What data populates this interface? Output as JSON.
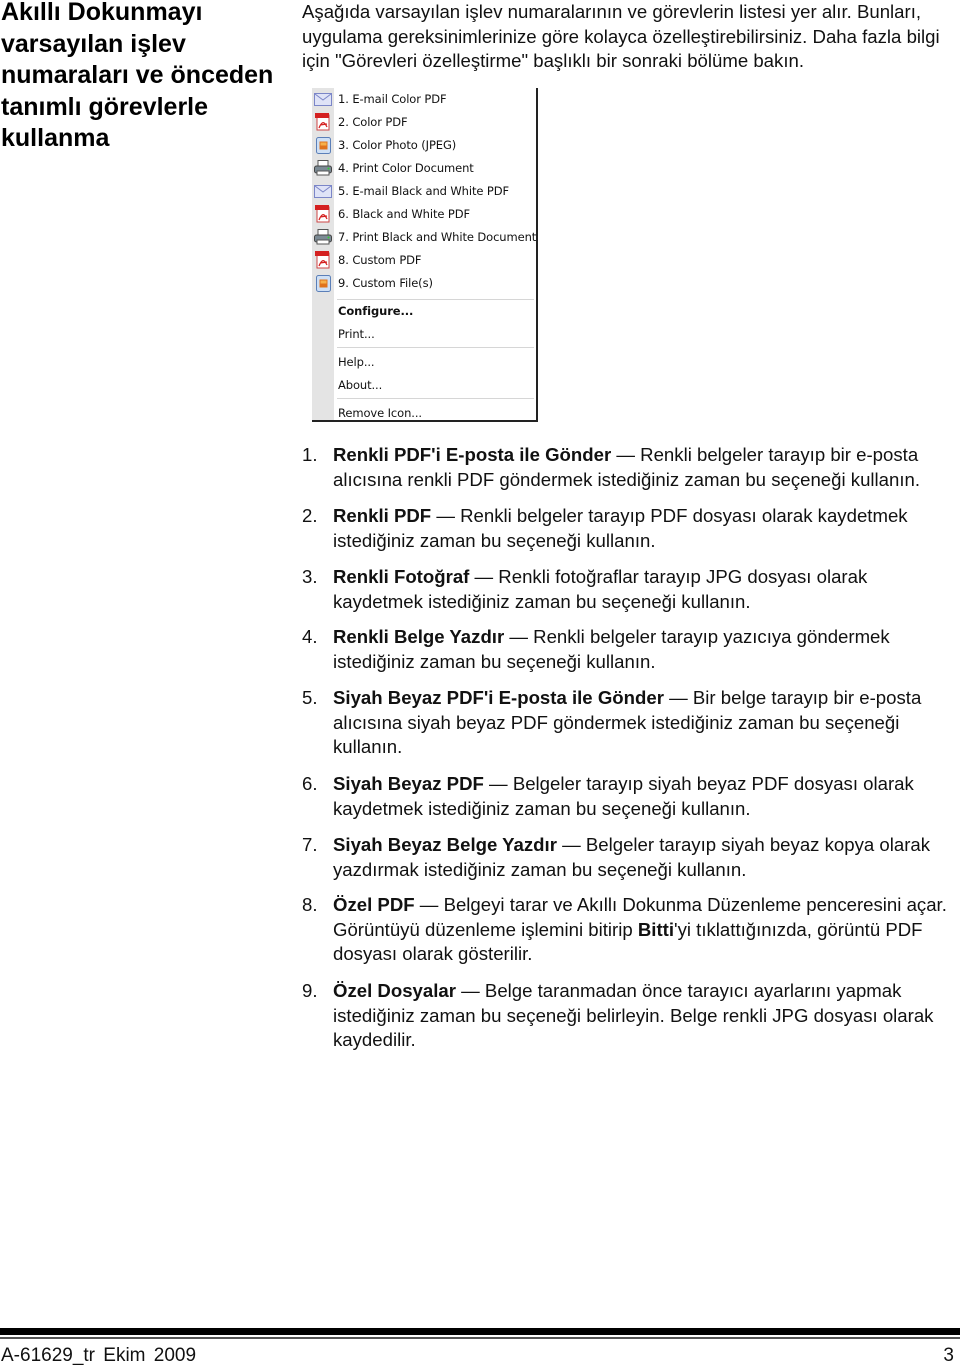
{
  "side_title": "Akıllı Dokunmayı varsayılan işlev numaraları ve önceden tanımlı görevlerle kullanma",
  "intro": "Aşağıda varsayılan işlev numaralarının ve görevlerin listesi yer alır. Bunları, uygulama gereksinimlerinize göre kolayca özelleştirebilirsiniz. Daha fazla bilgi için \"Görevleri özelleştirme\" başlıklı  bir sonraki bölüme bakın.",
  "menu": {
    "items": [
      {
        "label": "1. E-mail Color PDF",
        "icon": "envelope-icon"
      },
      {
        "label": "2. Color PDF",
        "icon": "pdf-icon"
      },
      {
        "label": "3. Color Photo (JPEG)",
        "icon": "photo-file-icon"
      },
      {
        "label": "4. Print Color Document",
        "icon": "printer-icon"
      },
      {
        "label": "5. E-mail Black and White PDF",
        "icon": "envelope-icon"
      },
      {
        "label": "6. Black and White PDF",
        "icon": "pdf-icon"
      },
      {
        "label": "7. Print Black and White Document",
        "icon": "printer-icon"
      },
      {
        "label": "8. Custom PDF",
        "icon": "pdf-icon"
      },
      {
        "label": "9. Custom File(s)",
        "icon": "photo-file-icon"
      }
    ],
    "configure": "Configure...",
    "print": "Print...",
    "help": "Help...",
    "about": "About...",
    "remove_icon": "Remove Icon..."
  },
  "tasks": [
    {
      "num": "1.",
      "title": "Renkli PDF'i E-posta ile Gönder",
      "sep": " — ",
      "text": "Renkli belgeler tarayıp bir e-posta alıcısına renkli PDF göndermek istediğiniz zaman bu seçeneği kullanın."
    },
    {
      "num": "2.",
      "title": "Renkli PDF",
      "sep": " — ",
      "text": "Renkli belgeler tarayıp PDF dosyası olarak kaydetmek istediğiniz zaman bu seçeneği kullanın."
    },
    {
      "num": "3.",
      "title": "Renkli Fotoğraf",
      "sep": " — ",
      "text": "Renkli fotoğraflar tarayıp JPG dosyası olarak kaydetmek istediğiniz zaman bu seçeneği kullanın."
    },
    {
      "num": "4.",
      "title": "Renkli Belge Yazdır",
      "sep": " — ",
      "text": "Renkli belgeler tarayıp yazıcıya göndermek istediğiniz zaman bu seçeneği kullanın."
    },
    {
      "num": "5.",
      "title": "Siyah Beyaz PDF'i E-posta ile Gönder",
      "sep": " — ",
      "text": "Bir belge tarayıp bir e-posta alıcısına siyah beyaz PDF göndermek istediğiniz zaman bu seçeneği kullanın."
    },
    {
      "num": "6.",
      "title": "Siyah Beyaz PDF",
      "sep": " — ",
      "text": "Belgeler tarayıp siyah beyaz PDF dosyası olarak kaydetmek istediğiniz zaman bu seçeneği kullanın."
    },
    {
      "num": "7.",
      "title": "Siyah Beyaz Belge Yazdır",
      "sep": " — ",
      "text": "Belgeler tarayıp siyah beyaz kopya olarak yazdırmak istediğiniz zaman bu seçeneği kullanın."
    },
    {
      "num": "8.",
      "title": "Özel PDF",
      "sep": " — ",
      "text_pre": "Belgeyi tarar ve Akıllı Dokunma Düzenleme penceresini açar. Görüntüyü düzenleme işlemini bitirip ",
      "text_bold": "Bitti",
      "text_post": "'yi tıklattığınızda, görüntü PDF dosyası olarak gösterilir."
    },
    {
      "num": "9.",
      "title": "Özel Dosyalar",
      "sep": " — ",
      "text": "Belge taranmadan önce tarayıcı ayarlarını yapmak istediğiniz zaman bu seçeneği belirleyin. Belge renkli JPG dosyası olarak kaydedilir."
    }
  ],
  "footer": {
    "doc_id": "A-61629_tr  Ekim  2009",
    "page_number": "3"
  }
}
